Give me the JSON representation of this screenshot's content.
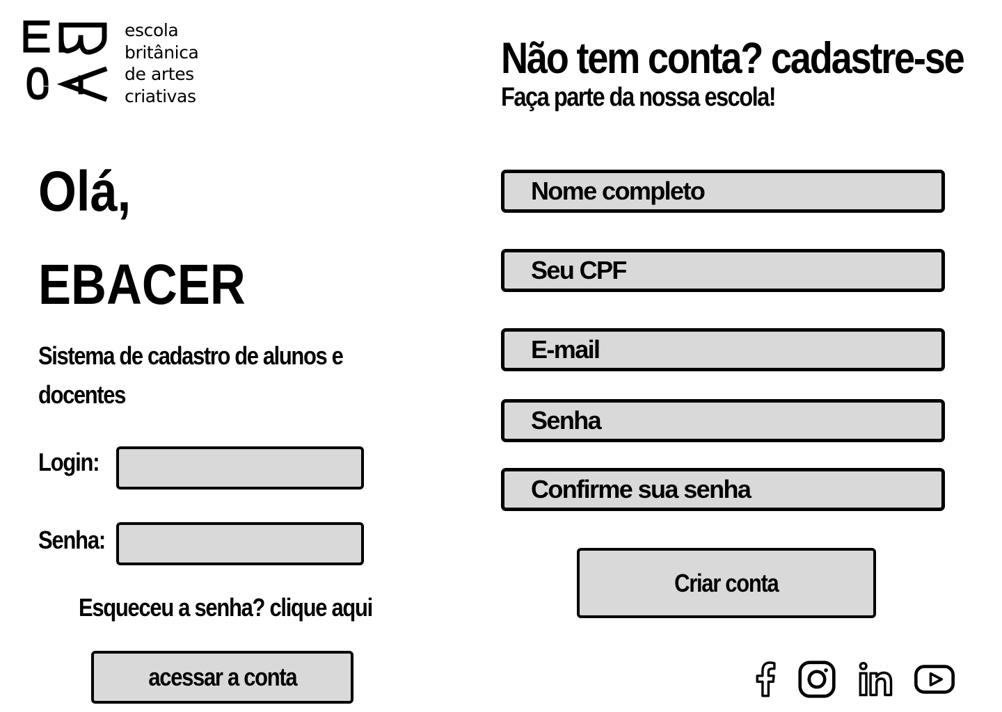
{
  "logo": {
    "lines": [
      "escola",
      "britânica",
      "de artes",
      "criativas"
    ]
  },
  "login_panel": {
    "greeting_line1": "Olá,",
    "greeting_line2": "EBACER",
    "subtitle": "Sistema de cadastro de alunos e docentes",
    "login_label": "Login:",
    "login_value": "",
    "password_label": "Senha:",
    "password_value": "",
    "forgot_link": "Esqueceu a senha? clique aqui",
    "access_button": "acessar a conta"
  },
  "register_panel": {
    "title": "Não tem conta? cadastre-se",
    "subtitle": "Faça parte da nossa escola!",
    "fields": {
      "full_name": "Nome completo",
      "cpf": "Seu CPF",
      "email": "E-mail",
      "password": "Senha",
      "confirm_password": "Confirme sua senha"
    },
    "create_button": "Criar conta"
  },
  "social_links": [
    {
      "icon": "facebook-icon"
    },
    {
      "icon": "instagram-icon"
    },
    {
      "icon": "linkedin-icon"
    },
    {
      "icon": "youtube-icon"
    }
  ],
  "colors": {
    "field_background": "#d9d9d9",
    "border": "#000000",
    "text": "#000000",
    "page_background": "#ffffff"
  }
}
